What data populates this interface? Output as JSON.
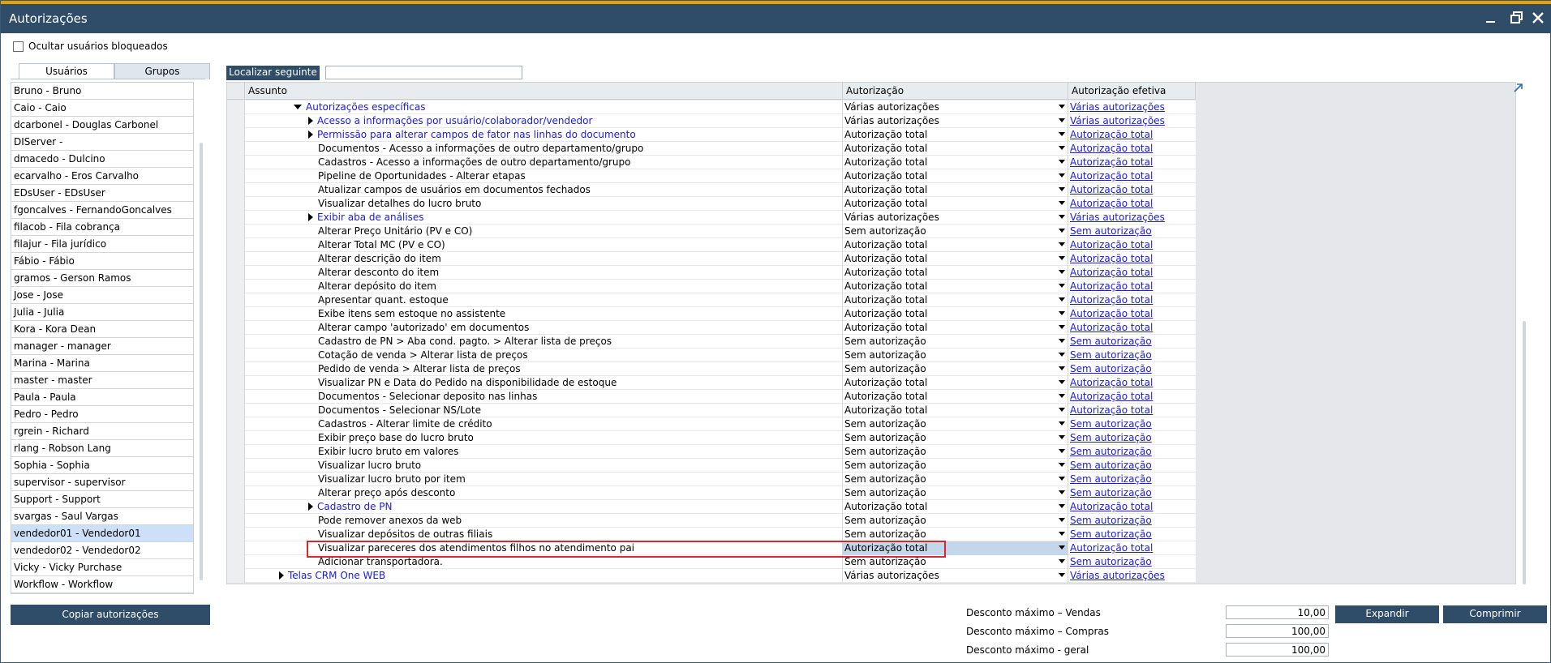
{
  "window": {
    "title": "Autorizações"
  },
  "options": {
    "hide_blocked_label": "Ocultar usuários bloqueados",
    "hide_blocked_checked": false
  },
  "tabs": [
    {
      "label": "Usuários",
      "active": true
    },
    {
      "label": "Grupos",
      "active": false
    }
  ],
  "users": [
    "Bruno - Bruno",
    "Caio - Caio",
    "dcarbonel - Douglas Carbonel",
    "DIServer -",
    "dmacedo - Dulcino",
    "ecarvalho - Eros Carvalho",
    "EDsUser - EDsUser",
    "fgoncalves - FernandoGoncalves",
    "filacob - Fila cobrança",
    "filajur - Fila jurídico",
    "Fábio - Fábio",
    "gramos - Gerson Ramos",
    "Jose - Jose",
    "Julia - Julia",
    "Kora - Kora Dean",
    "manager - manager",
    "Marina - Marina",
    "master - master",
    "Paula - Paula",
    "Pedro - Pedro",
    "rgrein - Richard",
    "rlang - Robson Lang",
    "Sophia - Sophia",
    "supervisor - supervisor",
    "Support - Support",
    "svargas - Saul Vargas",
    "vendedor01 - Vendedor01",
    "vendedor02 - Vendedor02",
    "Vicky - Vicky Purchase",
    "Workflow - Workflow"
  ],
  "selected_user": "vendedor01 - Vendedor01",
  "copy_button": "Copiar autorizações",
  "find_button": "Localizar seguinte",
  "find_value": "",
  "grid": {
    "headers": {
      "subject": "Assunto",
      "authorization": "Autorização",
      "effective": "Autorização efetiva"
    },
    "rows": [
      {
        "subject": "Autorizações específicas",
        "indent": 1,
        "expander": "down",
        "link": true,
        "auth": "Várias autorizações",
        "effective": "Várias autorizações"
      },
      {
        "subject": "Acesso a informações por usuário/colaborador/vendedor",
        "indent": 2,
        "expander": "right",
        "link": true,
        "auth": "Várias autorizações",
        "effective": "Várias autorizações"
      },
      {
        "subject": "Permissão para alterar campos de fator nas linhas do documento",
        "indent": 2,
        "expander": "right",
        "link": true,
        "auth": "Autorização total",
        "effective": "Autorização total"
      },
      {
        "subject": "Documentos - Acesso a informações de outro departamento/grupo",
        "indent": 2,
        "expander": "",
        "link": false,
        "auth": "Autorização total",
        "effective": "Autorização total"
      },
      {
        "subject": "Cadastros - Acesso a informações de outro departamento/grupo",
        "indent": 2,
        "expander": "",
        "link": false,
        "auth": "Autorização total",
        "effective": "Autorização total"
      },
      {
        "subject": "Pipeline de Oportunidades - Alterar etapas",
        "indent": 2,
        "expander": "",
        "link": false,
        "auth": "Autorização total",
        "effective": "Autorização total"
      },
      {
        "subject": "Atualizar campos de usuários em documentos fechados",
        "indent": 2,
        "expander": "",
        "link": false,
        "auth": "Autorização total",
        "effective": "Autorização total"
      },
      {
        "subject": "Visualizar detalhes do lucro bruto",
        "indent": 2,
        "expander": "",
        "link": false,
        "auth": "Autorização total",
        "effective": "Autorização total"
      },
      {
        "subject": "Exibir aba de análises",
        "indent": 2,
        "expander": "right",
        "link": true,
        "auth": "Várias autorizações",
        "effective": "Várias autorizações"
      },
      {
        "subject": "Alterar Preço Unitário (PV e CO)",
        "indent": 2,
        "expander": "",
        "link": false,
        "auth": "Sem autorização",
        "effective": "Sem autorização"
      },
      {
        "subject": "Alterar Total MC (PV e CO)",
        "indent": 2,
        "expander": "",
        "link": false,
        "auth": "Autorização total",
        "effective": "Autorização total"
      },
      {
        "subject": "Alterar descrição do item",
        "indent": 2,
        "expander": "",
        "link": false,
        "auth": "Autorização total",
        "effective": "Autorização total"
      },
      {
        "subject": "Alterar desconto do item",
        "indent": 2,
        "expander": "",
        "link": false,
        "auth": "Autorização total",
        "effective": "Autorização total"
      },
      {
        "subject": "Alterar depósito do item",
        "indent": 2,
        "expander": "",
        "link": false,
        "auth": "Autorização total",
        "effective": "Autorização total"
      },
      {
        "subject": "Apresentar quant. estoque",
        "indent": 2,
        "expander": "",
        "link": false,
        "auth": "Autorização total",
        "effective": "Autorização total"
      },
      {
        "subject": "Exibe itens sem estoque no assistente",
        "indent": 2,
        "expander": "",
        "link": false,
        "auth": "Autorização total",
        "effective": "Autorização total"
      },
      {
        "subject": "Alterar campo 'autorizado' em documentos",
        "indent": 2,
        "expander": "",
        "link": false,
        "auth": "Autorização total",
        "effective": "Autorização total"
      },
      {
        "subject": "Cadastro de PN > Aba cond. pagto. > Alterar lista de preços",
        "indent": 2,
        "expander": "",
        "link": false,
        "auth": "Sem autorização",
        "effective": "Sem autorização"
      },
      {
        "subject": "Cotação de venda > Alterar lista de preços",
        "indent": 2,
        "expander": "",
        "link": false,
        "auth": "Sem autorização",
        "effective": "Sem autorização"
      },
      {
        "subject": "Pedido de venda > Alterar lista de preços",
        "indent": 2,
        "expander": "",
        "link": false,
        "auth": "Sem autorização",
        "effective": "Sem autorização"
      },
      {
        "subject": "Visualizar PN e Data do Pedido na disponibilidade de estoque",
        "indent": 2,
        "expander": "",
        "link": false,
        "auth": "Autorização total",
        "effective": "Autorização total"
      },
      {
        "subject": "Documentos - Selecionar deposito nas linhas",
        "indent": 2,
        "expander": "",
        "link": false,
        "auth": "Autorização total",
        "effective": "Autorização total"
      },
      {
        "subject": "Documentos - Selecionar NS/Lote",
        "indent": 2,
        "expander": "",
        "link": false,
        "auth": "Autorização total",
        "effective": "Autorização total"
      },
      {
        "subject": "Cadastros - Alterar limite de crédito",
        "indent": 2,
        "expander": "",
        "link": false,
        "auth": "Sem autorização",
        "effective": "Sem autorização"
      },
      {
        "subject": "Exibir preço base do lucro bruto",
        "indent": 2,
        "expander": "",
        "link": false,
        "auth": "Sem autorização",
        "effective": "Sem autorização"
      },
      {
        "subject": "Exibir lucro bruto em valores",
        "indent": 2,
        "expander": "",
        "link": false,
        "auth": "Sem autorização",
        "effective": "Sem autorização"
      },
      {
        "subject": "Visualizar lucro bruto",
        "indent": 2,
        "expander": "",
        "link": false,
        "auth": "Sem autorização",
        "effective": "Sem autorização"
      },
      {
        "subject": "Visualizar lucro bruto por item",
        "indent": 2,
        "expander": "",
        "link": false,
        "auth": "Sem autorização",
        "effective": "Sem autorização"
      },
      {
        "subject": "Alterar preço após desconto",
        "indent": 2,
        "expander": "",
        "link": false,
        "auth": "Sem autorização",
        "effective": "Sem autorização"
      },
      {
        "subject": "Cadastro de PN",
        "indent": 2,
        "expander": "right",
        "link": true,
        "auth": "Autorização total",
        "effective": "Autorização total"
      },
      {
        "subject": "Pode remover anexos da web",
        "indent": 2,
        "expander": "",
        "link": false,
        "auth": "Sem autorização",
        "effective": "Sem autorização"
      },
      {
        "subject": "Visualizar depósitos de outras filiais",
        "indent": 2,
        "expander": "",
        "link": false,
        "auth": "Sem autorização",
        "effective": "Sem autorização"
      },
      {
        "subject": "Visualizar pareceres dos atendimentos filhos no atendimento pai",
        "indent": 2,
        "expander": "",
        "link": false,
        "auth": "Autorização total",
        "effective": "Autorização total",
        "selected": true
      },
      {
        "subject": "Adicionar transportadora.",
        "indent": 2,
        "expander": "",
        "link": false,
        "auth": "Sem autorização",
        "effective": "Sem autorização"
      },
      {
        "subject": "Telas CRM One WEB",
        "indent": 0,
        "expander": "right",
        "link": true,
        "auth": "Várias autorizações",
        "effective": "Várias autorizações"
      }
    ]
  },
  "discounts": {
    "sales_label": "Desconto máximo – Vendas",
    "sales_value": "10,00",
    "purchases_label": "Desconto máximo – Compras",
    "purchases_value": "100,00",
    "general_label": "Desconto máximo - geral",
    "general_value": "100,00"
  },
  "buttons": {
    "expand": "Expandir",
    "collapse": "Comprimir"
  },
  "colors": {
    "titlebar": "#2f4c68",
    "accent_line": "#e8a200",
    "link": "#1a1ae0",
    "highlight": "#d62a2a",
    "selection": "#cde0f7"
  }
}
